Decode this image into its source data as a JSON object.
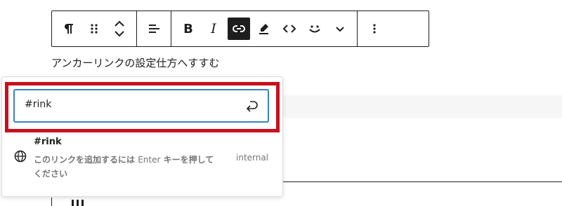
{
  "toolbar": {
    "buttons": [
      {
        "name": "paragraph-icon"
      },
      {
        "name": "drag-handle-icon"
      },
      {
        "name": "move-up-down-icon"
      },
      {
        "name": "align-left-icon"
      },
      {
        "name": "bold",
        "label": "B"
      },
      {
        "name": "italic",
        "label": "I"
      },
      {
        "name": "link-icon",
        "active": true
      },
      {
        "name": "highlighter-icon"
      },
      {
        "name": "inline-code-icon"
      },
      {
        "name": "emoji-icon"
      },
      {
        "name": "chevron-down-icon"
      },
      {
        "name": "more-options-icon"
      }
    ],
    "bold_label": "B",
    "italic_label": "I"
  },
  "paragraph": {
    "text": "アンカーリンクの設定仕方へすすむ"
  },
  "link_popover": {
    "input_value": "#rink",
    "suggestion": {
      "title": "#rink",
      "info_before": "このリンクを追加するには ",
      "info_key": "Enter",
      "info_after": " キーを押してください",
      "type": "internal"
    }
  },
  "colors": {
    "highlight_border": "#c8101c",
    "input_focus": "#3582c4",
    "active_button_bg": "#1e1e1e"
  }
}
